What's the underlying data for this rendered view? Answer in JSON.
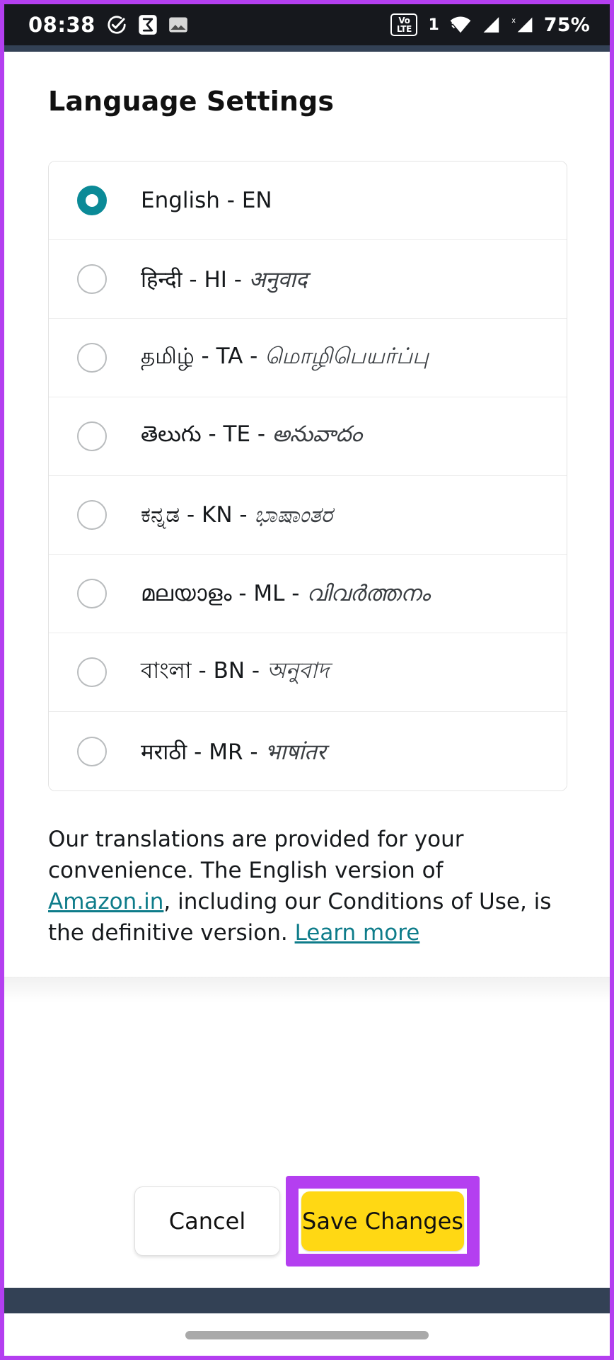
{
  "statusbar": {
    "time": "08:38",
    "battery": "75%",
    "volte_label_top": "Vo",
    "volte_label_bottom": "LTE",
    "sim_index": "1",
    "icons": [
      "check-circle-icon",
      "sigma-app-icon",
      "image-icon",
      "volte-icon",
      "wifi-icon",
      "signal-icon",
      "signal-x-icon"
    ]
  },
  "page": {
    "title": "Language Settings"
  },
  "languages": [
    {
      "name": "English",
      "code": "EN",
      "separator": "-",
      "translation": "",
      "selected": true
    },
    {
      "name": "हिन्दी",
      "code": "HI",
      "separator": "-",
      "translation": "अनुवाद",
      "selected": false
    },
    {
      "name": "தமிழ்",
      "code": "TA",
      "separator": "-",
      "translation": "மொழிபெயர்ப்பு",
      "selected": false
    },
    {
      "name": "తెలుగు",
      "code": "TE",
      "separator": "-",
      "translation": "అనువాదం",
      "selected": false
    },
    {
      "name": "ಕನ್ನಡ",
      "code": "KN",
      "separator": "-",
      "translation": "ಭಾಷಾಂತರ",
      "selected": false
    },
    {
      "name": "മലയാളം",
      "code": "ML",
      "separator": "-",
      "translation": "വിവർത്തനം",
      "selected": false
    },
    {
      "name": "বাংলা",
      "code": "BN",
      "separator": "-",
      "translation": "অনুবাদ",
      "selected": false
    },
    {
      "name": "मराठी",
      "code": "MR",
      "separator": "-",
      "translation": "भाषांतर",
      "selected": false
    }
  ],
  "disclaimer": {
    "part1": "Our translations are provided for your convenience. The English version of ",
    "link_site": "Amazon.in",
    "part2": ", including our Conditions of Use, is the definitive version. ",
    "link_learn": "Learn more"
  },
  "actions": {
    "cancel_label": "Cancel",
    "save_label": "Save Changes"
  },
  "colors": {
    "accent_teal": "#0b8a97",
    "link_teal": "#0e7c8a",
    "save_yellow": "#ffd814",
    "highlight_purple": "#b43ff0",
    "statusbar_bg": "#16181d",
    "strip_navy": "#334155"
  }
}
